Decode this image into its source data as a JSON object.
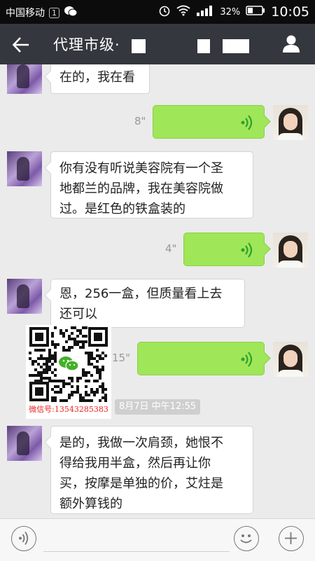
{
  "status_bar": {
    "carrier": "中国移动",
    "sim_slot": "1",
    "battery_percent": "32%",
    "time": "10:05"
  },
  "title_bar": {
    "title": "代理市级·"
  },
  "messages": [
    {
      "side": "left",
      "type": "text",
      "text": "在的，我在看"
    },
    {
      "side": "right",
      "type": "voice",
      "duration": "8\""
    },
    {
      "side": "left",
      "type": "text",
      "lines": [
        "你有没有听说美容院有一个圣",
        "地都兰的品牌，我在美容院做",
        "过。是红色的铁盒装的"
      ]
    },
    {
      "side": "right",
      "type": "voice",
      "duration": "4\""
    },
    {
      "side": "left",
      "type": "text",
      "lines": [
        "恩，256一盒，但质量看上去",
        "还可以"
      ]
    },
    {
      "side": "right",
      "type": "voice",
      "duration": "15\""
    },
    {
      "type": "timestamp",
      "text": "8月7日 中午12:55"
    },
    {
      "side": "left",
      "type": "text",
      "lines": [
        "是的，我做一次肩颈，她恨不",
        "得给我用半盒，然后再让你",
        "买，按摩是单独的价，艾炷是",
        "额外算钱的"
      ]
    }
  ],
  "overlay": {
    "wechat_id_caption": "微信号:13543285383"
  },
  "icons": {
    "back": "back-arrow-icon",
    "profile": "person-icon",
    "voice_mode": "voice-icon",
    "emoji": "emoji-icon",
    "more": "plus-icon",
    "voice_wave": "voice-wave-icon",
    "wifi": "wifi-icon",
    "signal": "signal-icon",
    "battery": "battery-icon",
    "alarm": "alarm-icon",
    "wechat": "wechat-icon"
  },
  "colors": {
    "title_bar": "#34373d",
    "voice_bubble": "#9fe658",
    "wave": "#2fa12a"
  }
}
